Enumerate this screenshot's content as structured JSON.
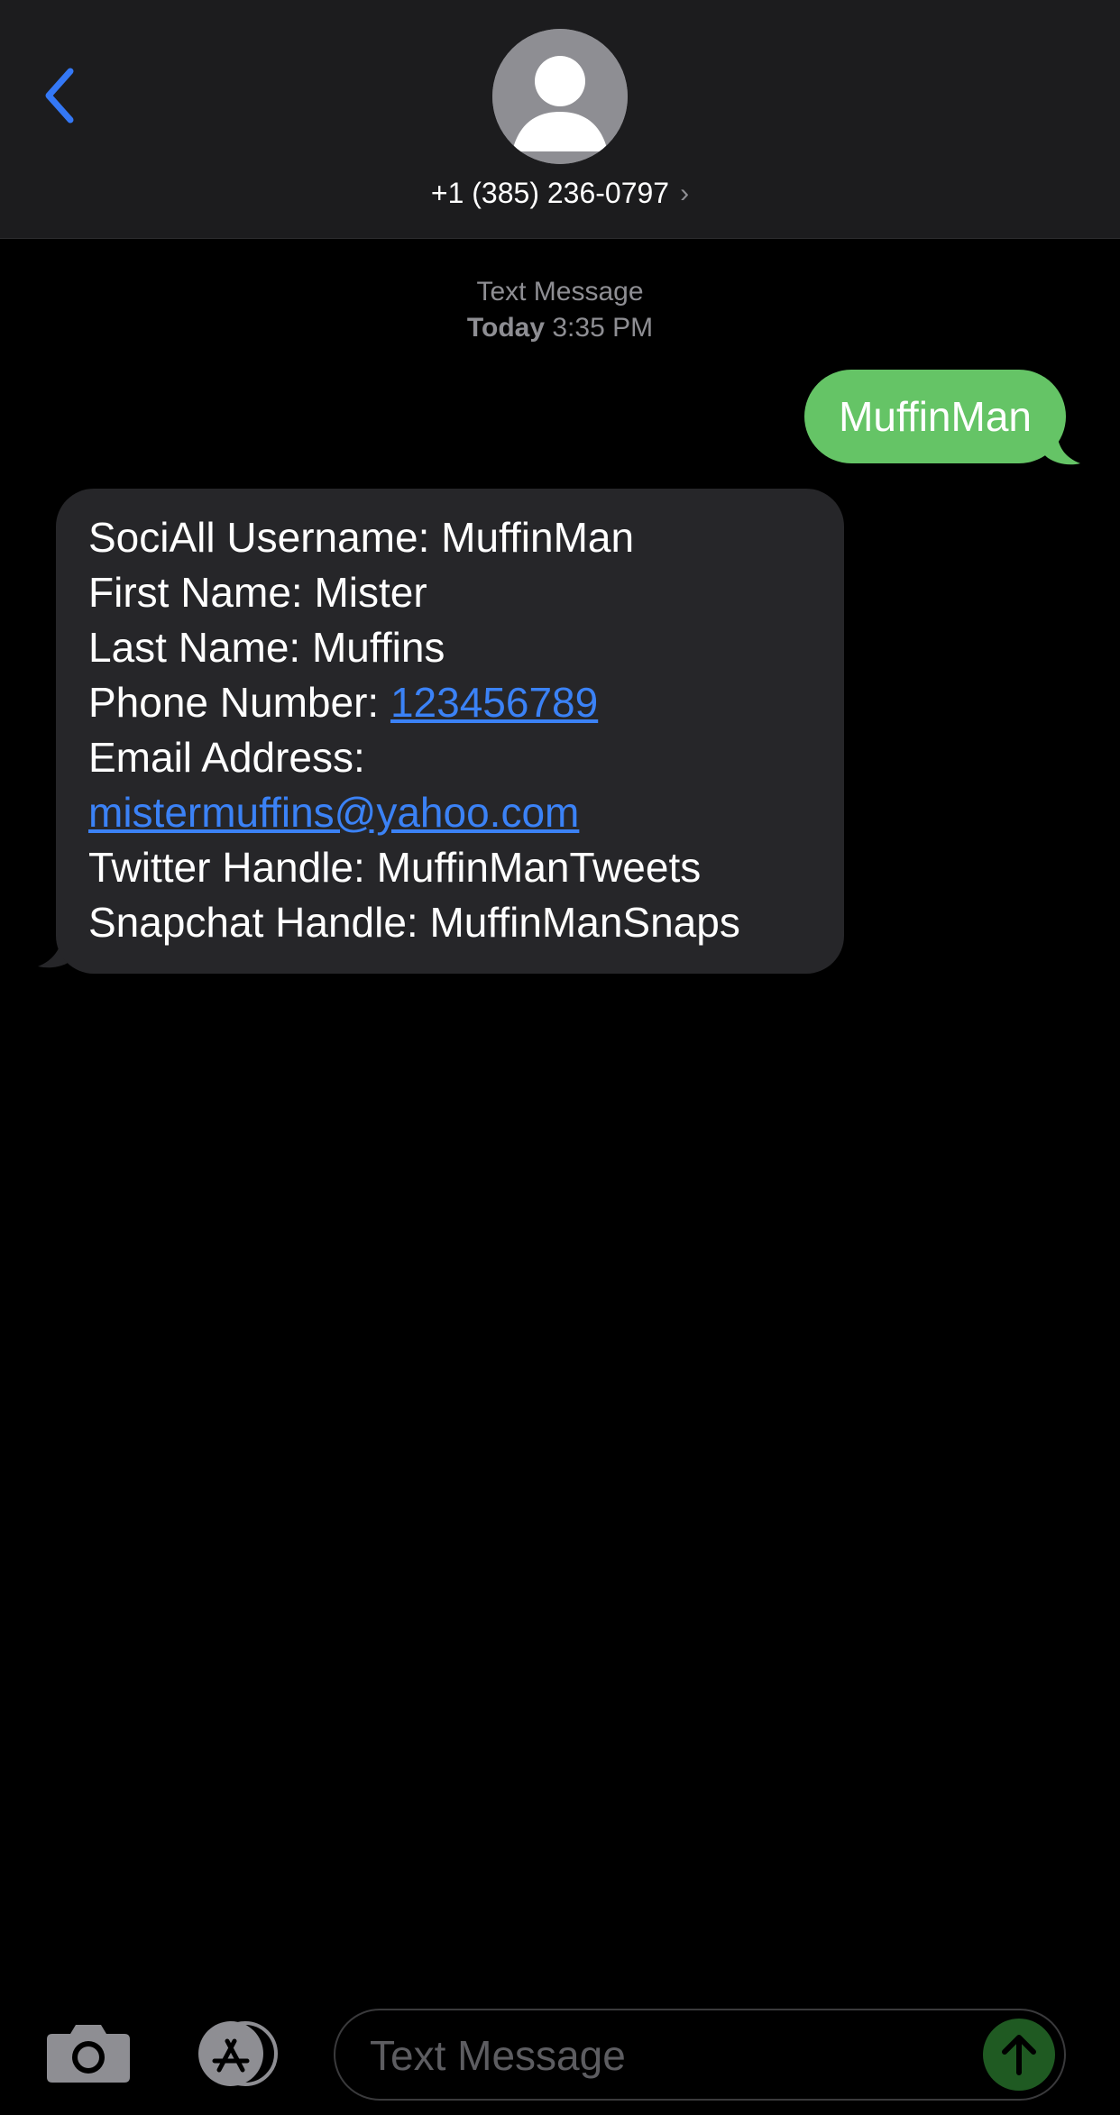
{
  "header": {
    "contact": "+1 (385) 236-0797",
    "chevron": "›"
  },
  "thread": {
    "service_label": "Text Message",
    "day": "Today",
    "time": "3:35 PM"
  },
  "messages": {
    "outgoing": {
      "text": "MuffinMan"
    },
    "incoming": {
      "line1": "SociAll Username: MuffinMan",
      "line2": "First Name: Mister",
      "line3": "Last Name: Muffins",
      "phone_label": "Phone Number: ",
      "phone_value": "123456789",
      "email_label": "Email Address:",
      "email_value": "mistermuffins@yahoo.com",
      "line7": "Twitter Handle: MuffinManTweets",
      "line8": "Snapchat Handle: MuffinManSnaps"
    }
  },
  "composer": {
    "placeholder": "Text Message",
    "value": ""
  },
  "colors": {
    "background": "#000000",
    "header": "#1c1c1e",
    "outgoing_bubble": "#65c466",
    "incoming_bubble": "#262629",
    "link": "#3b82f6",
    "accent": "#3478f6"
  },
  "icons": {
    "back": "chevron-left-icon",
    "avatar": "person-silhouette-icon",
    "camera": "camera-icon",
    "apps": "app-store-icon",
    "send": "arrow-up-icon"
  }
}
